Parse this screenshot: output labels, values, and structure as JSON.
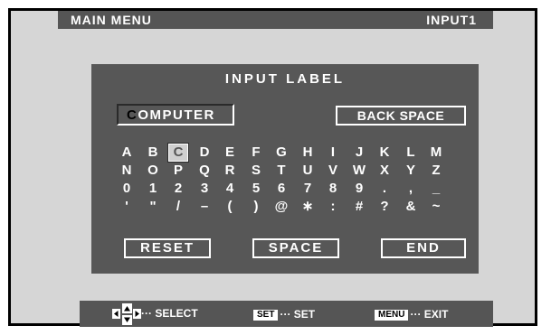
{
  "header": {
    "left": "MAIN  MENU",
    "right": "INPUT1"
  },
  "panel": {
    "title": "INPUT LABEL",
    "field_cursor_char": "C",
    "field_rest": "OMPUTER",
    "back_space": "BACK SPACE",
    "keys": [
      [
        "A",
        "B",
        "C",
        "D",
        "E",
        "F",
        "G",
        "H",
        "I",
        "J",
        "K",
        "L",
        "M"
      ],
      [
        "N",
        "O",
        "P",
        "Q",
        "R",
        "S",
        "T",
        "U",
        "V",
        "W",
        "X",
        "Y",
        "Z"
      ],
      [
        "0",
        "1",
        "2",
        "3",
        "4",
        "5",
        "6",
        "7",
        "8",
        "9",
        ".",
        ",",
        "_"
      ],
      [
        "'",
        "\"",
        "/",
        "–",
        "(",
        ")",
        "@",
        "∗",
        ":",
        "#",
        "?",
        "&",
        "~"
      ]
    ],
    "selected_key": "C",
    "reset": "RESET",
    "space": "SPACE",
    "end": "END"
  },
  "footer": {
    "select_label": "··· SELECT",
    "set_key": "SET",
    "set_label": "··· SET",
    "menu_key": "MENU",
    "exit_label": "··· EXIT",
    "icons": {
      "nav": "four-way-arrow-icon"
    }
  }
}
